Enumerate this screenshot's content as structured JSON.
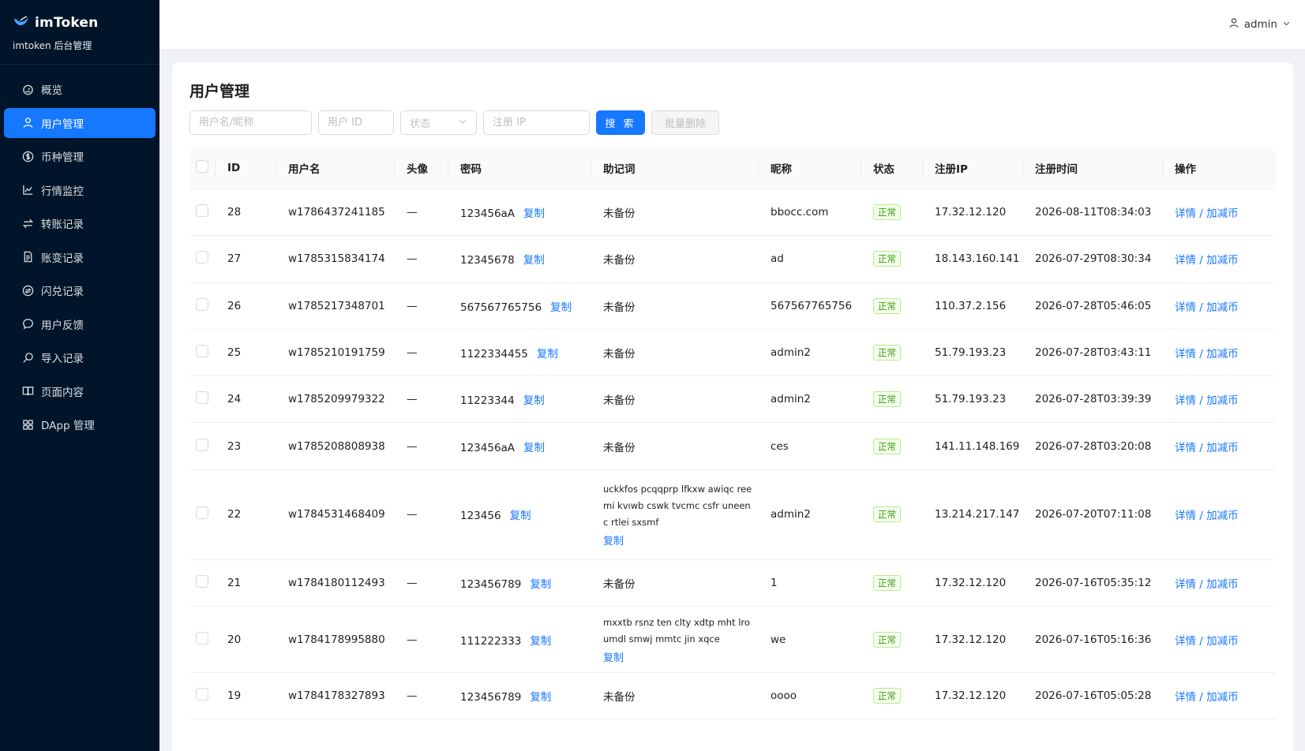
{
  "brand": {
    "name": "imToken",
    "subtitle": "imtoken 后台管理"
  },
  "sidebar": {
    "items": [
      {
        "label": "概览",
        "icon": "dashboard-icon",
        "active": false
      },
      {
        "label": "用户管理",
        "icon": "user-icon",
        "active": true
      },
      {
        "label": "币种管理",
        "icon": "coin-icon",
        "active": false
      },
      {
        "label": "行情监控",
        "icon": "line-chart-icon",
        "active": false
      },
      {
        "label": "转账记录",
        "icon": "swap-icon",
        "active": false
      },
      {
        "label": "账变记录",
        "icon": "file-icon",
        "active": false
      },
      {
        "label": "闪兑记录",
        "icon": "flash-swap-icon",
        "active": false
      },
      {
        "label": "用户反馈",
        "icon": "message-icon",
        "active": false
      },
      {
        "label": "导入记录",
        "icon": "search-icon",
        "active": false
      },
      {
        "label": "页面内容",
        "icon": "book-icon",
        "active": false
      },
      {
        "label": "DApp 管理",
        "icon": "appstore-icon",
        "active": false
      }
    ]
  },
  "header": {
    "user": "admin"
  },
  "page": {
    "title": "用户管理"
  },
  "filters": {
    "username_placeholder": "用户名/昵称",
    "userid_placeholder": "用户 ID",
    "status_placeholder": "状态",
    "ip_placeholder": "注册 IP",
    "search_label": "搜 索",
    "batch_delete_label": "批量删除"
  },
  "table": {
    "columns": [
      "ID",
      "用户名",
      "头像",
      "密码",
      "助记词",
      "昵称",
      "状态",
      "注册IP",
      "注册时间",
      "操作"
    ],
    "copy_label": "复制",
    "action_label": "详情 / 加减币",
    "rows": [
      {
        "id": "28",
        "username": "w1786437241185",
        "avatar": "—",
        "password": "123456aA",
        "mnemonic": "未备份",
        "mnemonic_full": false,
        "nickname": "bbocc.com",
        "status": "正常",
        "ip": "17.32.12.120",
        "time": "2026-08-11T08:34:03"
      },
      {
        "id": "27",
        "username": "w1785315834174",
        "avatar": "—",
        "password": "12345678",
        "mnemonic": "未备份",
        "mnemonic_full": false,
        "nickname": "ad",
        "status": "正常",
        "ip": "18.143.160.141",
        "time": "2026-07-29T08:30:34"
      },
      {
        "id": "26",
        "username": "w1785217348701",
        "avatar": "—",
        "password": "567567765756",
        "mnemonic": "未备份",
        "mnemonic_full": false,
        "nickname": "567567765756",
        "status": "正常",
        "ip": "110.37.2.156",
        "time": "2026-07-28T05:46:05"
      },
      {
        "id": "25",
        "username": "w1785210191759",
        "avatar": "—",
        "password": "1122334455",
        "mnemonic": "未备份",
        "mnemonic_full": false,
        "nickname": "admin2",
        "status": "正常",
        "ip": "51.79.193.23",
        "time": "2026-07-28T03:43:11"
      },
      {
        "id": "24",
        "username": "w1785209979322",
        "avatar": "—",
        "password": "11223344",
        "mnemonic": "未备份",
        "mnemonic_full": false,
        "nickname": "admin2",
        "status": "正常",
        "ip": "51.79.193.23",
        "time": "2026-07-28T03:39:39"
      },
      {
        "id": "23",
        "username": "w1785208808938",
        "avatar": "—",
        "password": "123456aA",
        "mnemonic": "未备份",
        "mnemonic_full": false,
        "nickname": "ces",
        "status": "正常",
        "ip": "141.11.148.169",
        "time": "2026-07-28T03:20:08"
      },
      {
        "id": "22",
        "username": "w1784531468409",
        "avatar": "—",
        "password": "123456",
        "mnemonic_lines": [
          "uckkfos pcqqprp lfkxw awiqc ree",
          "mi kvıwb cswk tvcmc csfr uneen",
          "c rtlei sxsmf"
        ],
        "mnemonic_full": true,
        "nickname": "admin2",
        "status": "正常",
        "ip": "13.214.217.147",
        "time": "2026-07-20T07:11:08"
      },
      {
        "id": "21",
        "username": "w1784180112493",
        "avatar": "—",
        "password": "123456789",
        "mnemonic": "未备份",
        "mnemonic_full": false,
        "nickname": "1",
        "status": "正常",
        "ip": "17.32.12.120",
        "time": "2026-07-16T05:35:12"
      },
      {
        "id": "20",
        "username": "w1784178995880",
        "avatar": "—",
        "password": "111222333",
        "mnemonic_lines": [
          "mxxtb rsnz ten clty xdtp mht lro",
          "umdl smwj mmtc jin xqce"
        ],
        "mnemonic_full": true,
        "nickname": "we",
        "status": "正常",
        "ip": "17.32.12.120",
        "time": "2026-07-16T05:16:36"
      },
      {
        "id": "19",
        "username": "w1784178327893",
        "avatar": "—",
        "password": "123456789",
        "mnemonic": "未备份",
        "mnemonic_full": false,
        "nickname": "oooo",
        "status": "正常",
        "ip": "17.32.12.120",
        "time": "2026-07-16T05:05:28"
      }
    ]
  }
}
